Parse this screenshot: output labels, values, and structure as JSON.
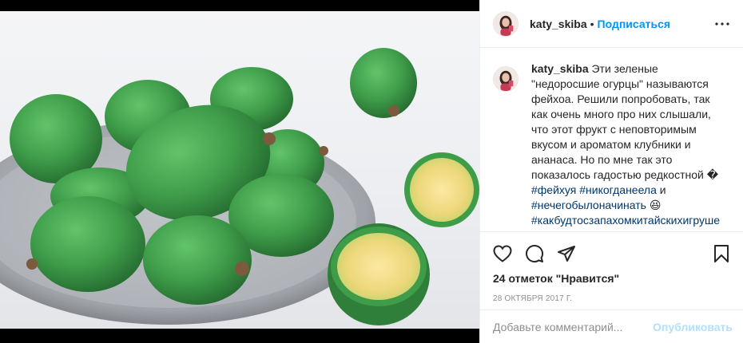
{
  "post": {
    "image_alt": "feijoa fruits on a plate",
    "header": {
      "username": "katy_skiba",
      "separator": "•",
      "follow_label": "Подписаться",
      "more_icon": "more-horizontal-icon"
    },
    "caption": {
      "username": "katy_skiba",
      "text_part1": " Эти зеленые \"недоросшие огурцы\" называются фейхоа. Решили попробовать, так как очень много про них слышали, что этот фрукт с неповторимым вкусом и ароматом клубники и ананаса. Но по мне так это показалось гадостью редкостной ",
      "emoji_unsupported": "�",
      "tag1": "#фейхуя",
      "tag2": "#никогданеела",
      "and": " и ",
      "tag3": "#нечегобылоначинать",
      "emoji_laugh": "😆",
      "tag4": "#какбудтосзапахомкитайскихигрушек"
    },
    "actions": {
      "like_icon": "heart-icon",
      "comment_icon": "comment-icon",
      "share_icon": "share-icon",
      "save_icon": "bookmark-icon"
    },
    "likes_text": "24 отметок \"Нравится\"",
    "date_text": "28 ОКТЯБРЯ 2017 Г.",
    "comment_box": {
      "placeholder": "Добавьте комментарий...",
      "publish_label": "Опубликовать"
    },
    "colors": {
      "link_blue": "#0095f6",
      "tag_blue": "#00376b",
      "publish_disabled": "#b2dffc",
      "feijoa_green": "#3f9d4a"
    }
  }
}
